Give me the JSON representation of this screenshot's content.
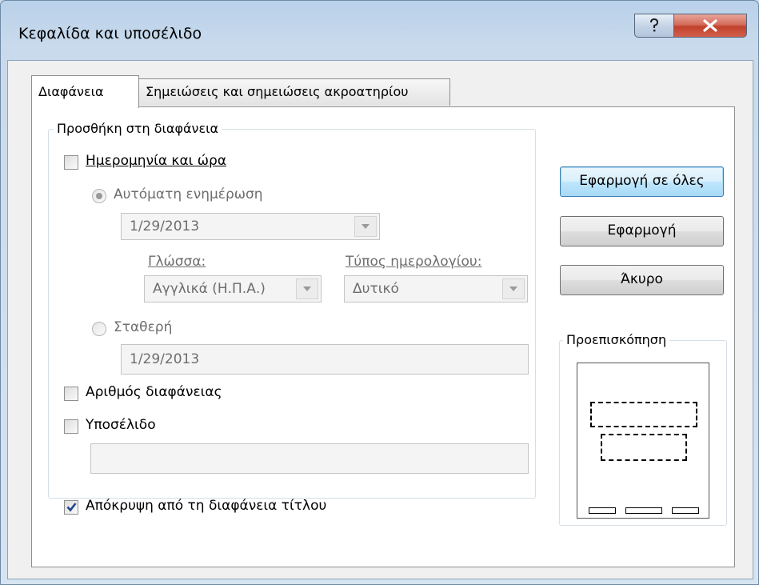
{
  "window": {
    "title": "Κεφαλίδα και υποσέλιδο",
    "help_label": "?",
    "close_label": "x"
  },
  "tabs": [
    {
      "label": "Διαφάνεια",
      "active": true
    },
    {
      "label": "Σημειώσεις και σημειώσεις ακροατηρίου",
      "active": false
    }
  ],
  "include_group": {
    "legend": "Προσθήκη στη διαφάνεια",
    "date_time": {
      "label": "Ημερομηνία και ώρα",
      "checked": false
    },
    "auto_update": {
      "label": "Αυτόματη ενημέρωση",
      "selected": true,
      "date_value": "1/29/2013"
    },
    "language": {
      "label": "Γλώσσα:",
      "value": "Αγγλικά (Η.Π.Α.)"
    },
    "calendar_type": {
      "label": "Τύπος ημερολογίου:",
      "value": "Δυτικό"
    },
    "fixed": {
      "label": "Σταθερή",
      "selected": false,
      "value": "1/29/2013"
    },
    "slide_number": {
      "label": "Αριθμός διαφάνειας",
      "checked": false
    },
    "footer": {
      "label": "Υποσέλιδο",
      "checked": false,
      "value": ""
    }
  },
  "hide_title": {
    "label": "Απόκρυψη από τη διαφάνεια τίτλου",
    "checked": true
  },
  "buttons": {
    "apply_all": "Εφαρμογή σε όλες",
    "apply": "Εφαρμογή",
    "cancel": "Άκυρο"
  },
  "preview": {
    "legend": "Προεπισκόπηση"
  },
  "colors": {
    "accent": "#3c7fb1",
    "close_red": "#c2412c"
  }
}
